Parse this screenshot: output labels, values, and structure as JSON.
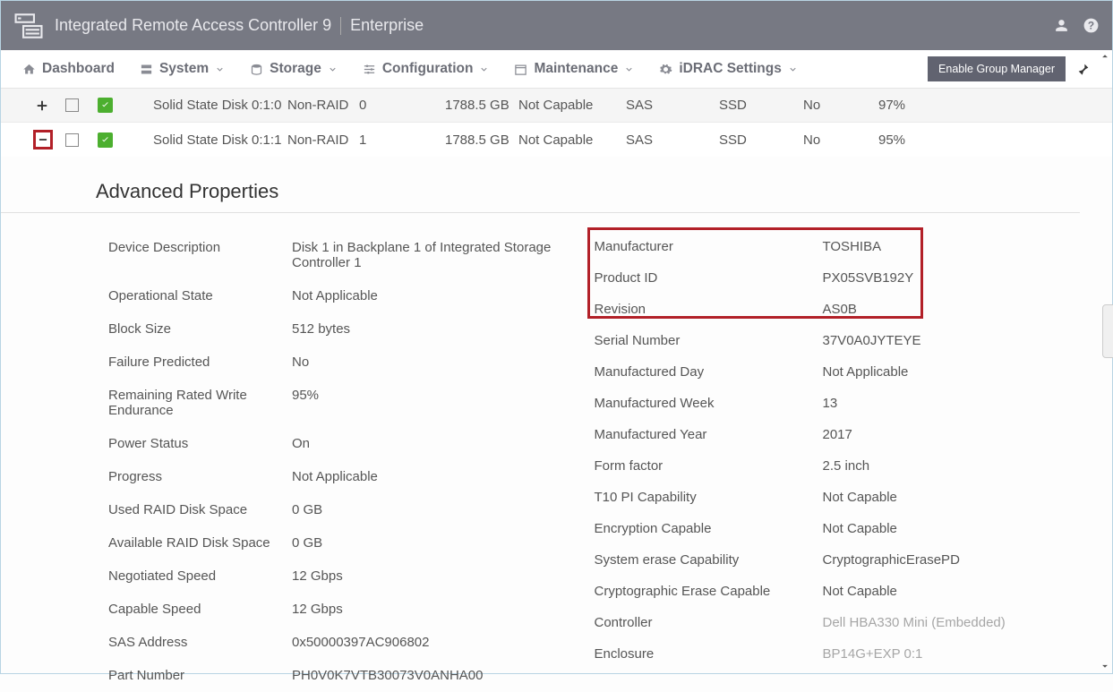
{
  "header": {
    "title_main": "Integrated Remote Access Controller 9",
    "title_edition": "Enterprise"
  },
  "nav": {
    "dashboard": "Dashboard",
    "system": "System",
    "storage": "Storage",
    "configuration": "Configuration",
    "maintenance": "Maintenance",
    "idrac": "iDRAC Settings",
    "group_mgr_btn": "Enable Group Manager"
  },
  "disks": [
    {
      "name": "Solid State Disk 0:1:0",
      "state": "Non-RAID",
      "slot": "0",
      "capacity": "1788.5 GB",
      "security": "Not Capable",
      "bus": "SAS",
      "media": "SSD",
      "hotspare": "No",
      "endurance": "97%"
    },
    {
      "name": "Solid State Disk 0:1:1",
      "state": "Non-RAID",
      "slot": "1",
      "capacity": "1788.5 GB",
      "security": "Not Capable",
      "bus": "SAS",
      "media": "SSD",
      "hotspare": "No",
      "endurance": "95%"
    }
  ],
  "section_title": "Advanced Properties",
  "props_left": [
    {
      "k": "Device Description",
      "v": "Disk 1 in Backplane 1 of Integrated Storage Controller 1"
    },
    {
      "k": "Operational State",
      "v": "Not Applicable"
    },
    {
      "k": "Block Size",
      "v": "512 bytes"
    },
    {
      "k": "Failure Predicted",
      "v": "No"
    },
    {
      "k": "Remaining Rated Write Endurance",
      "v": "95%"
    },
    {
      "k": "Power Status",
      "v": "On"
    },
    {
      "k": "Progress",
      "v": "Not Applicable"
    },
    {
      "k": "Used RAID Disk Space",
      "v": "0 GB"
    },
    {
      "k": "Available RAID Disk Space",
      "v": "0 GB"
    },
    {
      "k": "Negotiated Speed",
      "v": "12 Gbps"
    },
    {
      "k": "Capable Speed",
      "v": "12 Gbps"
    },
    {
      "k": "SAS Address",
      "v": "0x50000397AC906802"
    },
    {
      "k": "Part Number",
      "v": "PH0V0K7VTB30073V0ANHA00"
    }
  ],
  "props_right": [
    {
      "k": "Manufacturer",
      "v": "TOSHIBA"
    },
    {
      "k": "Product ID",
      "v": "PX05SVB192Y"
    },
    {
      "k": "Revision",
      "v": "AS0B"
    },
    {
      "k": "Serial Number",
      "v": "37V0A0JYTEYE"
    },
    {
      "k": "Manufactured Day",
      "v": "Not Applicable"
    },
    {
      "k": "Manufactured Week",
      "v": "13"
    },
    {
      "k": "Manufactured Year",
      "v": "2017"
    },
    {
      "k": "Form factor",
      "v": "2.5 inch"
    },
    {
      "k": "T10 PI Capability",
      "v": "Not Capable"
    },
    {
      "k": "Encryption Capable",
      "v": "Not Capable"
    },
    {
      "k": "System erase Capability",
      "v": "CryptographicErasePD"
    },
    {
      "k": "Cryptographic Erase Capable",
      "v": "Not Capable"
    },
    {
      "k": "Controller",
      "v": "Dell HBA330 Mini (Embedded)",
      "muted": true
    },
    {
      "k": "Enclosure",
      "v": "BP14G+EXP 0:1",
      "muted": true
    }
  ]
}
